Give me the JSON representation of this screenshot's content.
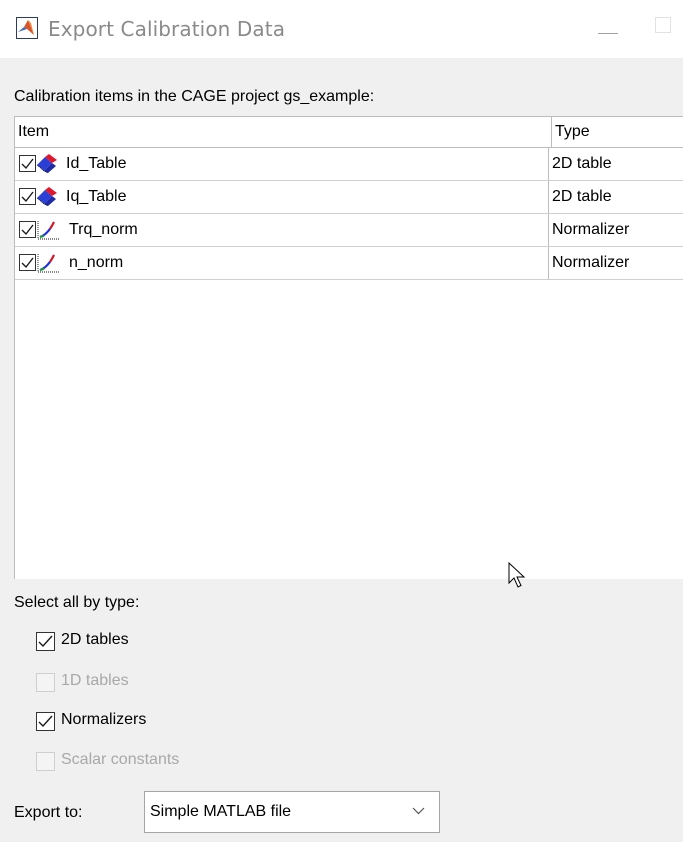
{
  "window": {
    "title": "Export Calibration Data"
  },
  "caption": "Calibration items in the CAGE project gs_example:",
  "table": {
    "columns": {
      "item": "Item",
      "type": "Type"
    },
    "rows": [
      {
        "name": "Id_Table",
        "type": "2D table",
        "icon": "table-2d-icon",
        "checked": true
      },
      {
        "name": "Iq_Table",
        "type": "2D table",
        "icon": "table-2d-icon",
        "checked": true
      },
      {
        "name": "Trq_norm",
        "type": "Normalizer",
        "icon": "normalizer-icon",
        "checked": true
      },
      {
        "name": "n_norm",
        "type": "Normalizer",
        "icon": "normalizer-icon",
        "checked": true
      }
    ]
  },
  "select_by_type": {
    "label": "Select all by type:",
    "options": [
      {
        "label": "2D tables",
        "checked": true,
        "enabled": true
      },
      {
        "label": "1D tables",
        "checked": false,
        "enabled": false
      },
      {
        "label": "Normalizers",
        "checked": true,
        "enabled": true
      },
      {
        "label": "Scalar constants",
        "checked": false,
        "enabled": false
      }
    ]
  },
  "export": {
    "label": "Export to:",
    "selected": "Simple MATLAB file"
  },
  "colors": {
    "check_mark": "#1a1a1a",
    "disabled_text": "#a8a8a8"
  }
}
